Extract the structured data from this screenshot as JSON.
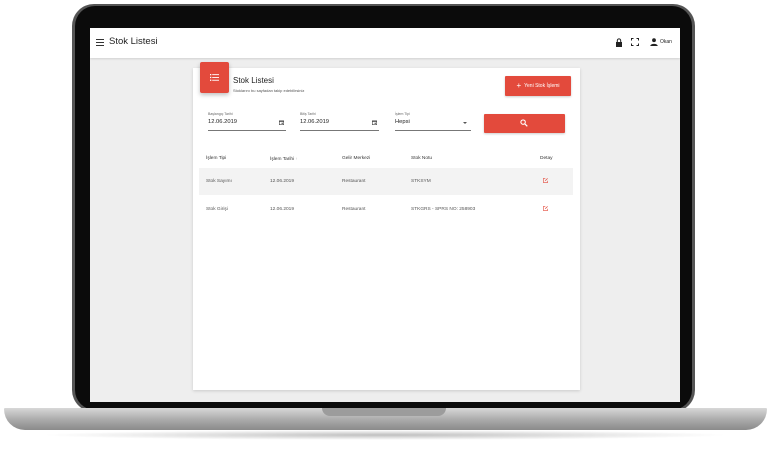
{
  "app": {
    "title": "Stok Listesi",
    "user": "Okan"
  },
  "card": {
    "title": "Stok Listesi",
    "subtitle": "Stoklarını bu sayfadan takip edebilirsiniz",
    "new_button": "Yeni Stok İşlemi"
  },
  "filters": {
    "start_label": "Başlangıç Tarihi",
    "start_value": "12.06.2019",
    "end_label": "Bitiş Tarihi",
    "end_value": "12.06.2019",
    "type_label": "İşlem Tipi",
    "type_value": "Hepsi"
  },
  "table": {
    "headers": [
      "İşlem Tipi",
      "İşlem Tarihi",
      "Gelir Merkezi",
      "Stok Notu",
      "Detay"
    ],
    "rows": [
      [
        "Stok Sayımı",
        "12.06.2019",
        "Restaurant",
        "STKSYM"
      ],
      [
        "Stok Girişi",
        "12.06.2019",
        "Restaurant",
        "STKGRS - SPRS NO: 258903"
      ]
    ]
  },
  "colors": {
    "accent": "#e34a3c",
    "background": "#eeeeee"
  },
  "icons": [
    "menu-icon",
    "lock-icon",
    "fullscreen-icon",
    "user-icon",
    "list-icon",
    "plus-icon",
    "calendar-icon",
    "chevron-down-icon",
    "search-icon",
    "sort-icon",
    "edit-icon"
  ]
}
